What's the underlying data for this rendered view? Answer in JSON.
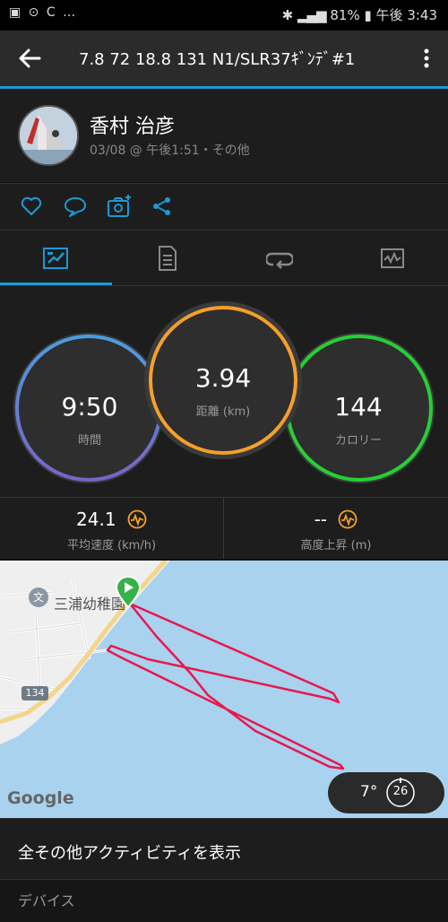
{
  "status_bar": {
    "left_icons": "▣ ⊙ C …",
    "battery": "81%",
    "time": "午後 3:43"
  },
  "app_bar": {
    "title": "7.8  72  18.8  131  N1/SLR37ｷﾞﾝﾃﾞ#1"
  },
  "profile": {
    "name": "香村 治彦",
    "meta": "03/08 @ 午後1:51・その他"
  },
  "stats": {
    "time_value": "9:50",
    "time_label": "時間",
    "distance_value": "3.94",
    "distance_label": "距離 (km)",
    "calories_value": "144",
    "calories_label": "カロリー"
  },
  "metrics": {
    "avg_speed_value": "24.1",
    "avg_speed_label": "平均速度 (km/h)",
    "elev_gain_value": "--",
    "elev_gain_label": "高度上昇 (m)"
  },
  "map": {
    "poi_label": "三浦幼稚園",
    "road_number": "134",
    "google_logo": "Google",
    "temperature": "7°",
    "wind_value": "26"
  },
  "show_all_label": "全その他アクティビティを表示",
  "devices_label": "デバイス",
  "colors": {
    "accent_blue": "#1a9ad6",
    "ring_blue": "#4a9de0",
    "ring_purple": "#7b63c9",
    "ring_orange": "#f5a02a",
    "ring_green": "#25d035",
    "track": "#e8174e"
  }
}
